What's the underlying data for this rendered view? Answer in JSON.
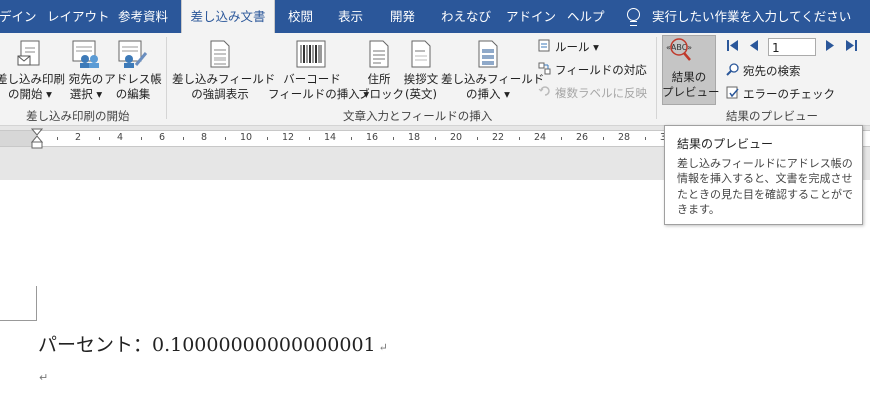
{
  "tabs": [
    {
      "label": "デイン"
    },
    {
      "label": "レイアウト"
    },
    {
      "label": "参考資料"
    },
    {
      "label": "差し込み文書"
    },
    {
      "label": "校閲"
    },
    {
      "label": "表示"
    },
    {
      "label": "開発"
    },
    {
      "label": "わえなび"
    },
    {
      "label": "アドイン"
    },
    {
      "label": "ヘルプ"
    }
  ],
  "tell_me": "実行したい作業を入力してください",
  "groups": {
    "start": {
      "label": "差し込み印刷の開始",
      "start_mailmerge": [
        "差し込み印刷",
        "の開始 ▾"
      ],
      "select_recipients": [
        "宛先の",
        "選択 ▾"
      ],
      "edit_list": [
        "アドレス帳",
        "の編集"
      ]
    },
    "fields": {
      "label": "文章入力とフィールドの挿入",
      "highlight": [
        "差し込みフィールド",
        "の強調表示"
      ],
      "barcode": [
        "バーコード",
        "フィールドの挿入 ▾"
      ],
      "address": [
        "住所",
        "ブロック"
      ],
      "greeting": [
        "挨拶文",
        "(英文)"
      ],
      "insert_field": [
        "差し込みフィールド",
        "の挿入 ▾"
      ],
      "rules": "ルール ▾",
      "match_fields": "フィールドの対応",
      "update_labels": "複数ラベルに反映"
    },
    "preview": {
      "label": "結果のプレビュー",
      "preview_btn": [
        "結果の",
        "プレビュー"
      ],
      "record": "1",
      "find_recipient": "宛先の検索",
      "check_errors": "エラーのチェック"
    }
  },
  "ruler_numbers": [
    "2",
    "4",
    "6",
    "8",
    "10",
    "12",
    "14",
    "16",
    "18",
    "20",
    "22",
    "24",
    "26",
    "28",
    "3"
  ],
  "document": {
    "line1": "パーセント：0.10000000000000001",
    "para_mark": "↵"
  },
  "tooltip": {
    "title": "結果のプレビュー",
    "body": "差し込みフィールドにアドレス帳の情報を挿入すると、文書を完成させたときの見た目を確認することができます。"
  },
  "colors": {
    "accent": "#2b579a",
    "ribbon": "#f3f3f3"
  }
}
